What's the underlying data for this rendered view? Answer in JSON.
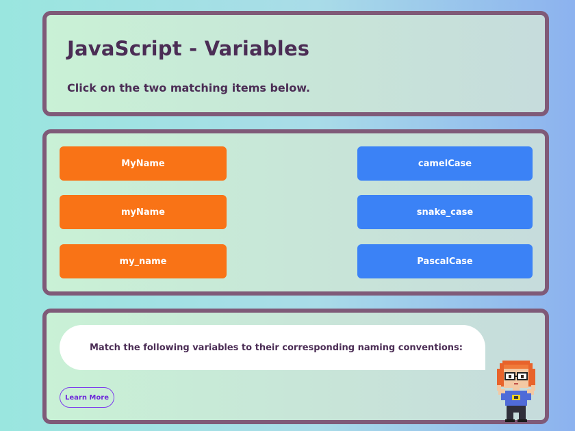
{
  "header": {
    "title": "JavaScript - Variables",
    "instruction": "Click on the two matching items below."
  },
  "matching": {
    "left_items": [
      {
        "label": "MyName"
      },
      {
        "label": "myName"
      },
      {
        "label": "my_name"
      }
    ],
    "right_items": [
      {
        "label": "camelCase"
      },
      {
        "label": "snake_case"
      },
      {
        "label": "PascalCase"
      }
    ]
  },
  "assistant": {
    "message": "Match the following variables to their corresponding naming conventions:",
    "learn_more_label": "Learn More",
    "mascot_icon": "pixel-girl-mascot-icon"
  },
  "colors": {
    "panel_border": "#7f5a78",
    "left_button": "#f97316",
    "right_button": "#3b82f6",
    "text_dark": "#4b2d55",
    "learn_more": "#7c3aed"
  }
}
